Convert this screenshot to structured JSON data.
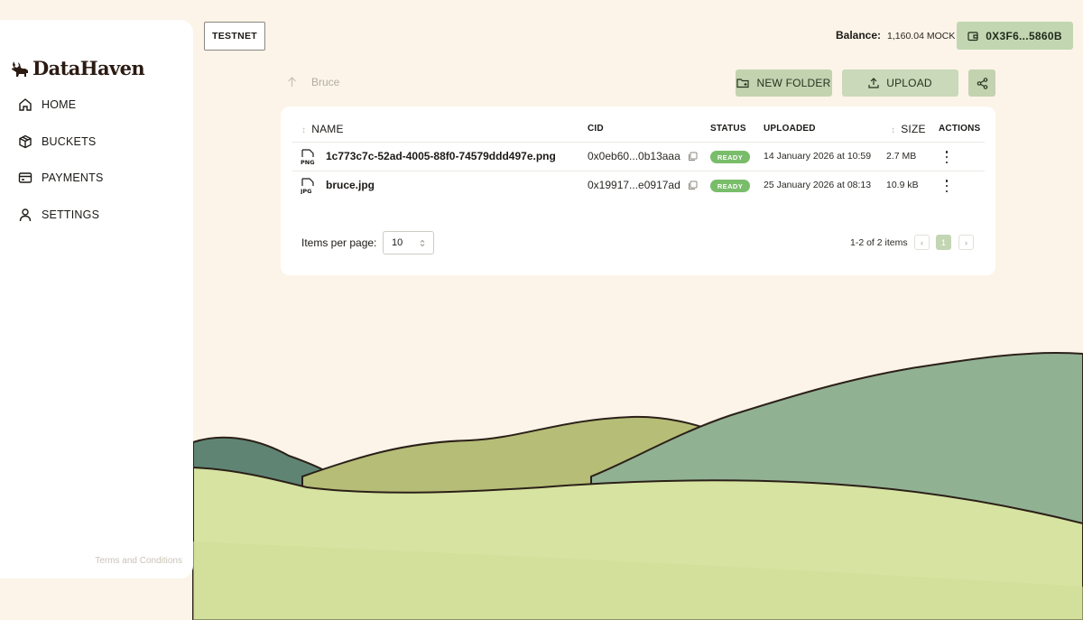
{
  "brand": {
    "name": "DataHaven"
  },
  "sidebar": {
    "items": [
      {
        "label": "HOME",
        "icon": "home-icon"
      },
      {
        "label": "BUCKETS",
        "icon": "buckets-icon"
      },
      {
        "label": "PAYMENTS",
        "icon": "payments-icon"
      },
      {
        "label": "SETTINGS",
        "icon": "settings-icon"
      }
    ],
    "terms": "Terms and Conditions"
  },
  "header": {
    "network": "TESTNET",
    "balance_label": "Balance:",
    "balance_value": "1,160.04 MOCK",
    "wallet_address": "0X3F6...5860B"
  },
  "breadcrumb": {
    "folder": "Bruce"
  },
  "actions": {
    "new_folder": "NEW FOLDER",
    "upload": "UPLOAD",
    "share_icon": "share-icon"
  },
  "table": {
    "columns": {
      "name": "NAME",
      "cid": "CID",
      "status": "STATUS",
      "uploaded": "UPLOADED",
      "size": "SIZE",
      "actions": "ACTIONS"
    },
    "rows": [
      {
        "type": "PNG",
        "name": "1c773c7c-52ad-4005-88f0-74579ddd497e.png",
        "cid": "0x0eb60...0b13aaa",
        "status": "READY",
        "uploaded": "14 January 2026 at 10:59",
        "size": "2.7 MB"
      },
      {
        "type": "JPG",
        "name": "bruce.jpg",
        "cid": "0x19917...e0917ad",
        "status": "READY",
        "uploaded": "25 January 2026 at 08:13",
        "size": "10.9 kB"
      }
    ]
  },
  "pagination": {
    "items_per_page_label": "Items per page:",
    "items_per_page": "10",
    "range": "1-2 of 2 items",
    "current_page": "1",
    "prev": "‹",
    "next": "›"
  },
  "colors": {
    "background": "#fcf4e8",
    "accent": "#c3d3b0",
    "ready_badge": "#79bd6b"
  }
}
